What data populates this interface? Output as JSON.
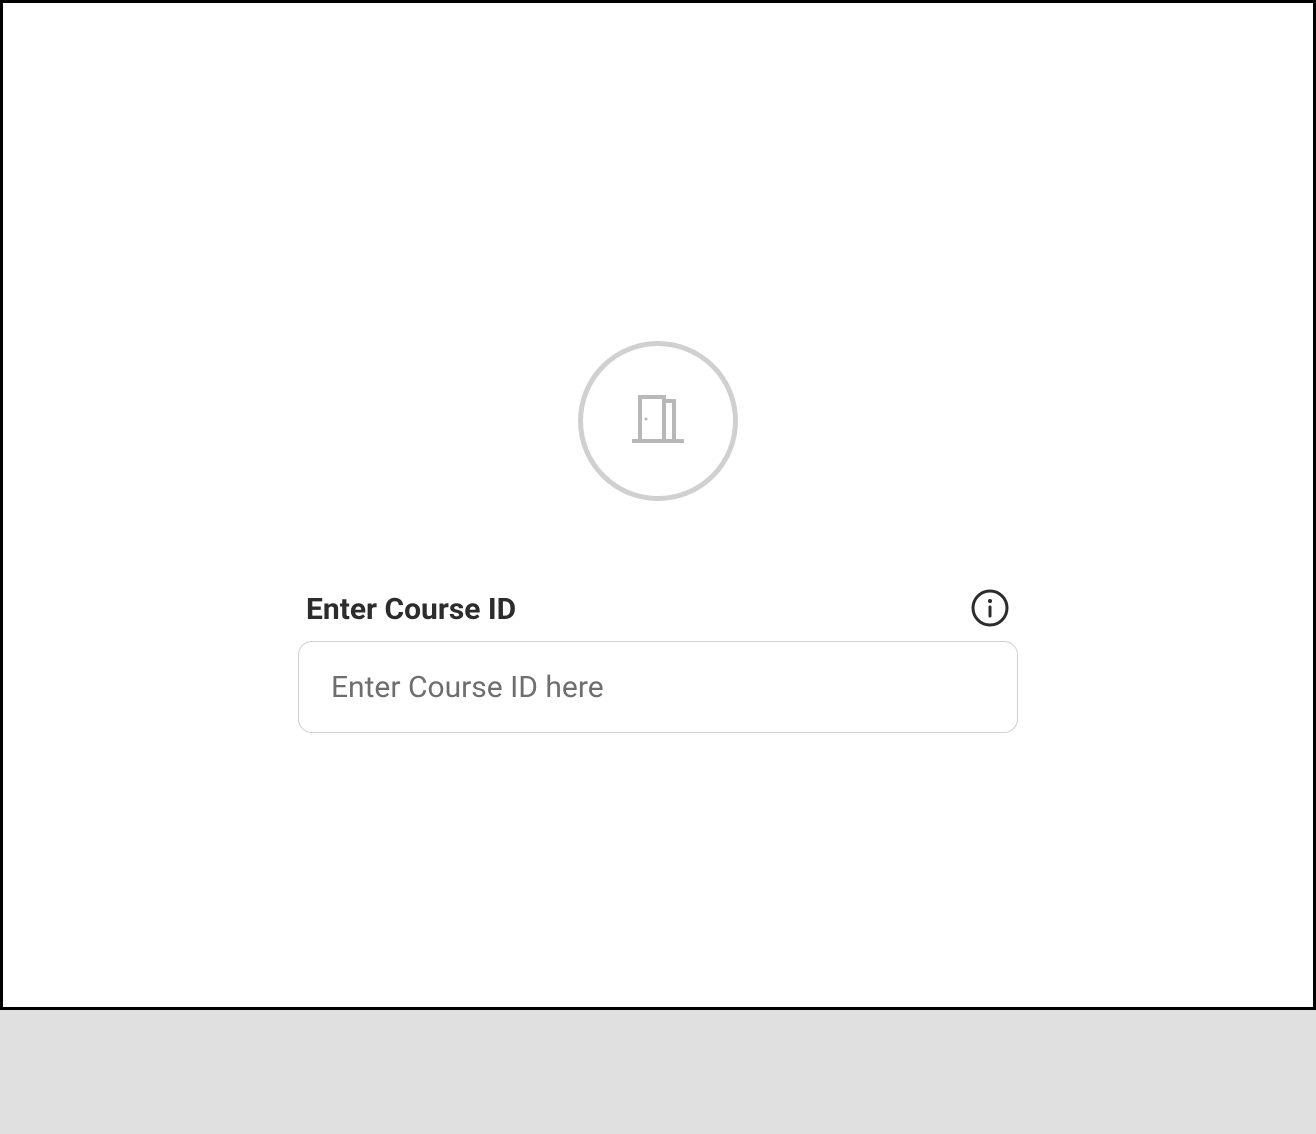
{
  "form": {
    "course_id": {
      "label": "Enter Course ID",
      "placeholder": "Enter Course ID here",
      "value": ""
    }
  },
  "icons": {
    "hero": "door-icon",
    "info": "info-icon"
  }
}
